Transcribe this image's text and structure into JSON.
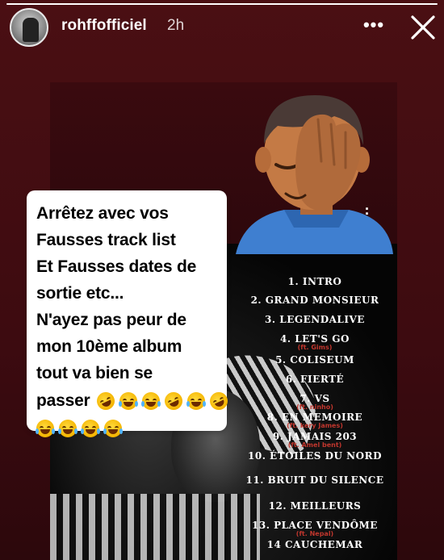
{
  "story": {
    "username": "rohffofficiel",
    "time": "2h",
    "progress": 1.0
  },
  "header": {
    "more_glyph": "•••",
    "close_icon": "close-icon"
  },
  "text_card": {
    "lines": [
      "Arrêtez avec vos",
      "Fausses track list",
      "Et Fausses dates de",
      "sortie etc...",
      "N'ayez pas peur de",
      "mon 10ème album",
      "tout va bien se"
    ],
    "last_word": "passer",
    "emoji_row_1": [
      "rofl",
      "joy",
      "joy",
      "rofl",
      "joy",
      "rofl"
    ],
    "emoji_row_2": [
      "joy",
      "joy",
      "cry",
      "cry"
    ]
  },
  "tracklist": {
    "tracks": [
      {
        "label": "1. INTRO"
      },
      {
        "label": "2. GRAND MONSIEUR"
      },
      {
        "label": "3. LEGENDALIVE"
      },
      {
        "label": "4. LET'S GO",
        "feat": "(ft. Gims)"
      },
      {
        "label": "5. COLISEUM"
      },
      {
        "label": "6. FIERTÉ"
      },
      {
        "label": "7. VS",
        "feat": "(ft. ninho)"
      },
      {
        "label": "8. EN MEMOIRE",
        "feat": "(ft. kery James)"
      },
      {
        "label": "9. JAMAIS 203",
        "feat": "(ft. Amel bent)"
      },
      {
        "label": "10. ÉTOILES DU NORD"
      },
      {
        "label": "11. BRUIT DU SILENCE"
      },
      {
        "label": "12. MEILLEURS"
      },
      {
        "label": "13. PLACE VENDÔME",
        "feat": "(ft. Nepal)"
      },
      {
        "label": "14 CAUCHEMAR"
      }
    ]
  },
  "colors": {
    "background": "#3d0b10",
    "card_text": "#000000",
    "tracklist_text": "#ffffff",
    "feat_text": "#c0362d"
  }
}
